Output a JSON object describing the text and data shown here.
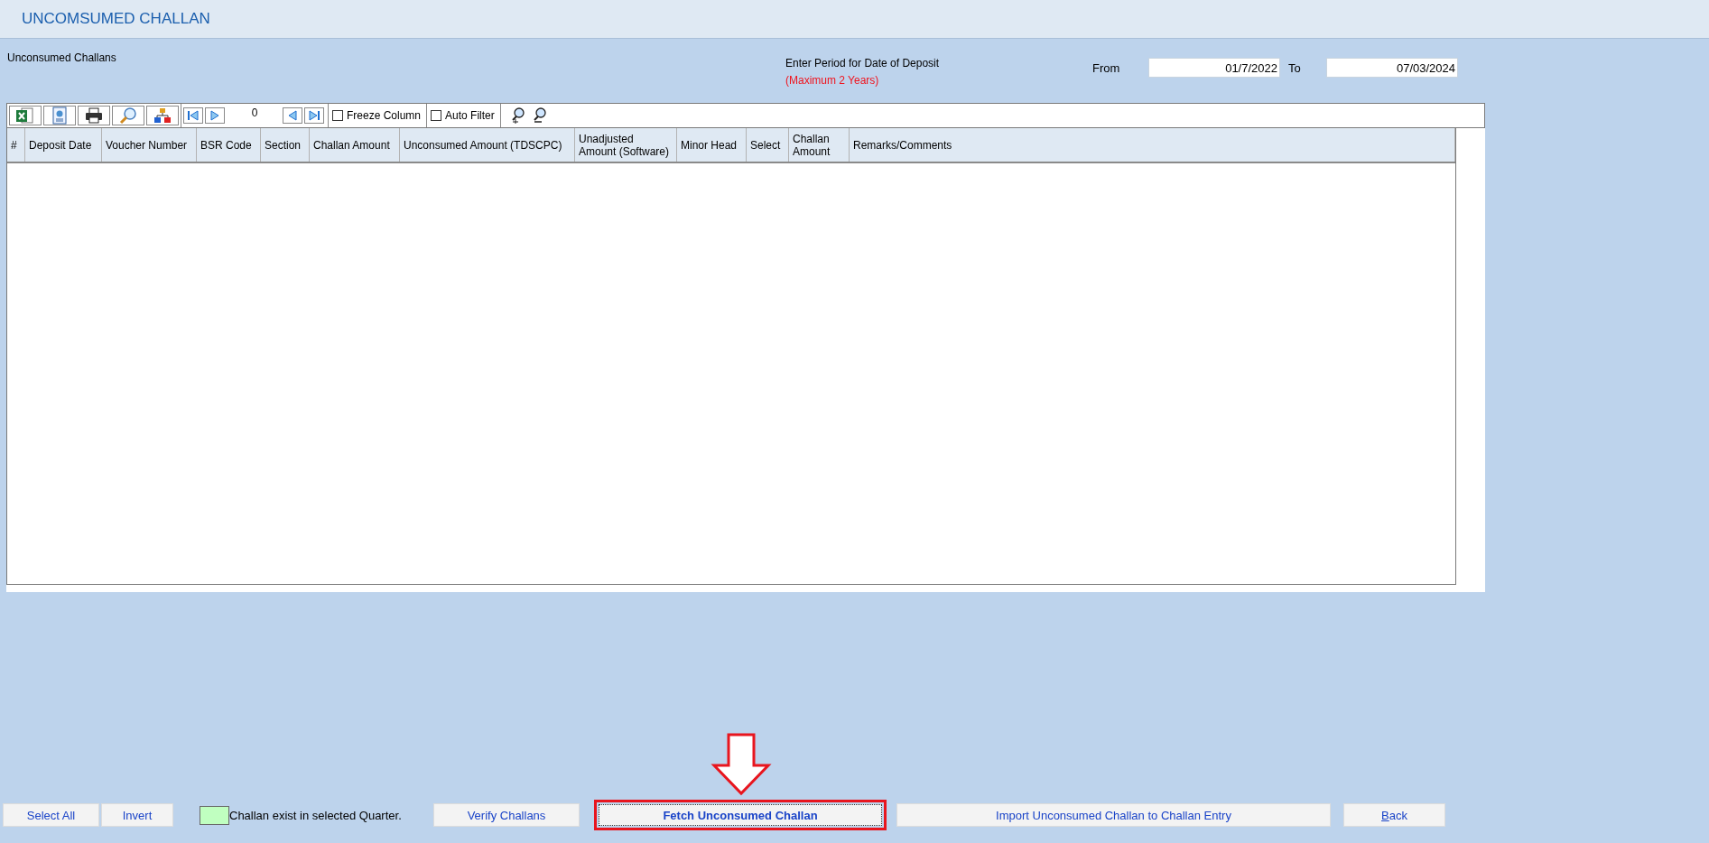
{
  "window": {
    "title": "UNCOMSUMED CHALLAN"
  },
  "section_label": "Unconsumed Challans",
  "period": {
    "label": "Enter Period for Date of Deposit",
    "note": "(Maximum 2 Years)",
    "from_label": "From",
    "from_value": "01/7/2022",
    "to_label": "To",
    "to_value": "07/03/2024"
  },
  "toolbar": {
    "record_count": "0",
    "options": [
      {
        "label": "Freeze Column",
        "checked": false
      },
      {
        "label": "Auto Filter",
        "checked": false
      }
    ]
  },
  "table": {
    "columns": [
      "#",
      "Deposit Date",
      "Voucher Number",
      "BSR Code",
      "Section",
      "Challan Amount",
      "Unconsumed Amount (TDSCPC)",
      "Unadjusted Amount (Software)",
      "Minor Head",
      "Select",
      "Challan Amount",
      "Remarks/Comments"
    ]
  },
  "selection_buttons": [
    "Select All",
    "Invert"
  ],
  "legend": {
    "color": "#c0ffc0",
    "label": "Challan exist in selected Quarter."
  },
  "buttons": [
    {
      "label": "Verify Challans",
      "kind": "plain"
    },
    {
      "label": "Fetch Unconsumed Challan",
      "kind": "highlighted"
    },
    {
      "label": "Import Unconsumed Challan to Challan Entry",
      "kind": "plain"
    },
    {
      "label": "Back",
      "kind": "accesskey"
    }
  ]
}
